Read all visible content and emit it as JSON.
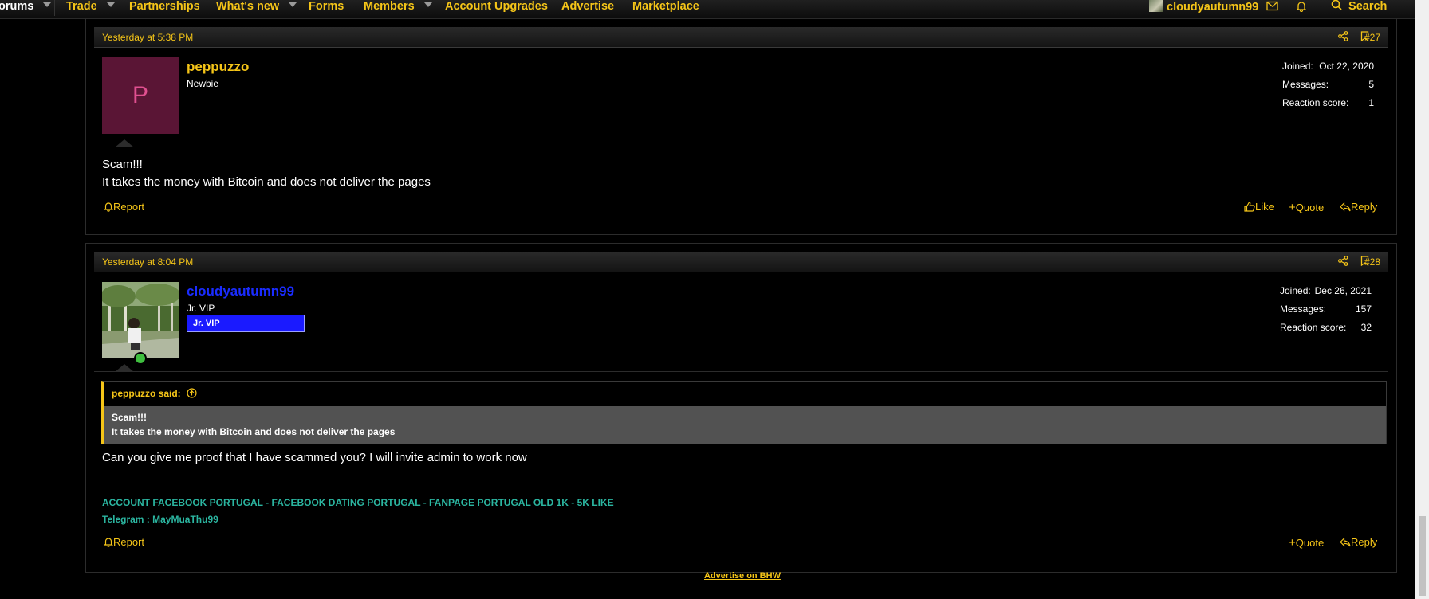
{
  "nav": {
    "forums_label": "orums",
    "items": [
      {
        "label": "Trade"
      },
      {
        "label": "Partnerships"
      },
      {
        "label": "What's new"
      },
      {
        "label": "Forms"
      },
      {
        "label": "Members"
      },
      {
        "label": "Account Upgrades"
      },
      {
        "label": "Advertise"
      },
      {
        "label": "Marketplace"
      }
    ],
    "account_name": "cloudyautumn99",
    "search_label": "Search"
  },
  "posts": [
    {
      "date": "Yesterday at 5:38 PM",
      "number": "#27",
      "avatar_letter": "P",
      "username": "peppuzzo",
      "user_title": "Newbie",
      "stats": [
        {
          "label": "Joined:",
          "value": "Oct 22, 2020"
        },
        {
          "label": "Messages:",
          "value": "5"
        },
        {
          "label": "Reaction score:",
          "value": "1"
        }
      ],
      "body": [
        "Scam!!!",
        "It takes the money with Bitcoin and does not deliver the pages"
      ],
      "report_label": "Report",
      "like_label": "Like",
      "quote_label": "Quote",
      "reply_label": "Reply"
    },
    {
      "date": "Yesterday at 8:04 PM",
      "number": "#28",
      "username": "cloudyautumn99",
      "user_title": "Jr. VIP",
      "banner": "Jr. VIP",
      "stats": [
        {
          "label": "Joined:",
          "value": "Dec 26, 2021"
        },
        {
          "label": "Messages:",
          "value": "157"
        },
        {
          "label": "Reaction score:",
          "value": "32"
        }
      ],
      "quote": {
        "author": "peppuzzo said:",
        "lines": [
          "Scam!!!",
          "It takes the money with Bitcoin and does not deliver the pages"
        ]
      },
      "body": "Can you give me proof that I have scammed you? I will invite admin to work now",
      "signature": [
        "ACCOUNT FACEBOOK PORTUGAL - FACEBOOK DATING PORTUGAL - FANPAGE PORTUGAL OLD 1K - 5K LIKE",
        "Telegram : MayMuaThu99"
      ],
      "report_label": "Report",
      "quote_label": "Quote",
      "reply_label": "Reply"
    }
  ],
  "footer": {
    "advertise_link": "Advertise on BHW"
  },
  "colors": {
    "accent": "#f5c518",
    "username_newbie": "#f5c518",
    "username_vip": "#1a2cff",
    "banner_bg": "#1a1aff",
    "signature": "#2bb5a0",
    "avatar_bg": "#5a1535"
  }
}
